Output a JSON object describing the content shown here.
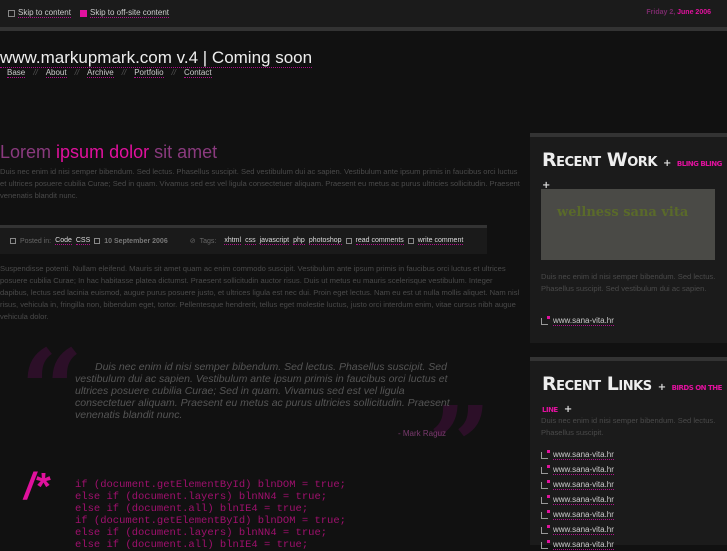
{
  "topbar": {
    "skip_content": "Skip to content",
    "skip_offsite": "Skip to off-site content",
    "date_day": "Friday 2,",
    "date_month": "June 2006"
  },
  "header": {
    "title": "www.markupmark.com v.4 | Coming soon",
    "nav": [
      "Base",
      "About",
      "Archive",
      "Portfolio",
      "Contact"
    ],
    "separator": "//"
  },
  "post": {
    "title_a": "Lorem",
    "title_b": "ipsum dolor",
    "title_c": "sit amet",
    "intro": "Duis nec enim id nisi semper bibendum. Sed lectus. Phasellus suscipit. Sed vestibulum dui ac sapien. Vestibulum ante ipsum primis in faucibus orci luctus et ultrices posuere cubilia Curae; Sed in quam. Vivamus sed est vel ligula consectetuer aliquam. Praesent eu metus ac purus ultricies sollicitudin. Praesent venenatis blandit nunc.",
    "meta": {
      "posted_in": "Posted in:",
      "categories": [
        "Code",
        "CSS"
      ],
      "date": "10 September 2006",
      "tags_label": "Tags:",
      "tags": [
        "xhtml",
        "css",
        "javascript",
        "php",
        "photoshop"
      ],
      "read_comments": "read comments",
      "write_comment": "write comment"
    },
    "body": "Suspendisse potenti. Nullam eleifend. Mauris sit amet quam ac enim commodo suscipit. Vestibulum ante ipsum primis in faucibus orci luctus et ultrices posuere cubilia Curae; In hac habitasse platea dictumst. Praesent sollicitudin auctor risus. Duis ut metus eu mauris scelerisque vestibulum. Integer dapibus, lectus sed lacinia euismod, augue purus posuere justo, et ultrices ligula est nec dui. Proin eget lectus. Nam eu est ut nulla mollis aliquet. Nam nisl risus, vehicula in, fringilla non, bibendum eget, tortor. Pellentesque hendrerit, tellus eget molestie luctus, justo orci interdum enim, vitae cursus nibh augue vehicula dolor.",
    "quote": "Duis nec enim id nisi semper bibendum. Sed lectus. Phasellus suscipit. Sed vestibulum dui ac sapien. Vestibulum ante ipsum primis in faucibus orci luctus et ultrices posuere cubilia Curae; Sed in quam. Vivamus sed est vel ligula consectetuer aliquam. Praesent eu metus ac purus ultricies sollicitudin. Praesent venenatis blandit nunc.",
    "quote_author": "- Mark Raguz",
    "comment_mark": "/*",
    "code": "if (document.getElementById) blnDOM = true;\nelse if (document.layers) blnNN4 = true;\nelse if (document.all) blnIE4 = true;\nif (document.getElementById) blnDOM = true;\nelse if (document.layers) blnNN4 = true;\nelse if (document.all) blnIE4 = true;"
  },
  "sidebar": {
    "work": {
      "title": "Recent Work",
      "tag": "BLING BLING",
      "image_text": "wellness sana vita",
      "text": "Duis nec enim id nisi semper bibendum. Sed lectus. Phasellus suscipit. Sed vestibulum dui ac sapien.",
      "link": "www.sana-vita.hr"
    },
    "links": {
      "title": "Recent Links",
      "tag": "BIRDS ON THE LINE",
      "text": "Duis nec enim id nisi semper bibendum. Sed lectus. Phasellus suscipit.",
      "items": [
        "www.sana-vita.hr",
        "www.sana-vita.hr",
        "www.sana-vita.hr",
        "www.sana-vita.hr",
        "www.sana-vita.hr",
        "www.sana-vita.hr",
        "www.sana-vita.hr"
      ]
    }
  },
  "colors": {
    "accent": "#e0119d",
    "background": "#111111"
  }
}
